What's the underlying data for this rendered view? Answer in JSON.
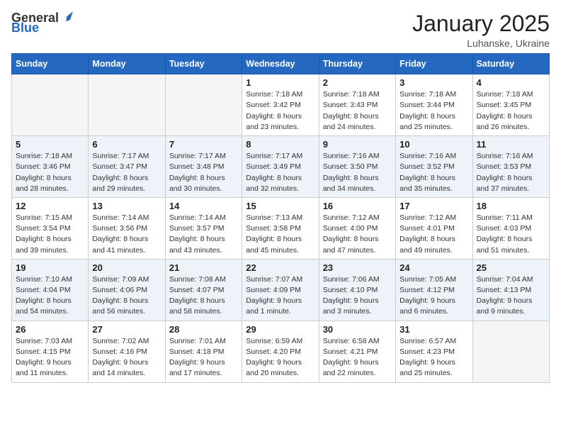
{
  "header": {
    "logo_general": "General",
    "logo_blue": "Blue",
    "month_title": "January 2025",
    "subtitle": "Luhanske, Ukraine"
  },
  "weekdays": [
    "Sunday",
    "Monday",
    "Tuesday",
    "Wednesday",
    "Thursday",
    "Friday",
    "Saturday"
  ],
  "weeks": [
    [
      {
        "day": "",
        "info": ""
      },
      {
        "day": "",
        "info": ""
      },
      {
        "day": "",
        "info": ""
      },
      {
        "day": "1",
        "info": "Sunrise: 7:18 AM\nSunset: 3:42 PM\nDaylight: 8 hours\nand 23 minutes."
      },
      {
        "day": "2",
        "info": "Sunrise: 7:18 AM\nSunset: 3:43 PM\nDaylight: 8 hours\nand 24 minutes."
      },
      {
        "day": "3",
        "info": "Sunrise: 7:18 AM\nSunset: 3:44 PM\nDaylight: 8 hours\nand 25 minutes."
      },
      {
        "day": "4",
        "info": "Sunrise: 7:18 AM\nSunset: 3:45 PM\nDaylight: 8 hours\nand 26 minutes."
      }
    ],
    [
      {
        "day": "5",
        "info": "Sunrise: 7:18 AM\nSunset: 3:46 PM\nDaylight: 8 hours\nand 28 minutes."
      },
      {
        "day": "6",
        "info": "Sunrise: 7:17 AM\nSunset: 3:47 PM\nDaylight: 8 hours\nand 29 minutes."
      },
      {
        "day": "7",
        "info": "Sunrise: 7:17 AM\nSunset: 3:48 PM\nDaylight: 8 hours\nand 30 minutes."
      },
      {
        "day": "8",
        "info": "Sunrise: 7:17 AM\nSunset: 3:49 PM\nDaylight: 8 hours\nand 32 minutes."
      },
      {
        "day": "9",
        "info": "Sunrise: 7:16 AM\nSunset: 3:50 PM\nDaylight: 8 hours\nand 34 minutes."
      },
      {
        "day": "10",
        "info": "Sunrise: 7:16 AM\nSunset: 3:52 PM\nDaylight: 8 hours\nand 35 minutes."
      },
      {
        "day": "11",
        "info": "Sunrise: 7:16 AM\nSunset: 3:53 PM\nDaylight: 8 hours\nand 37 minutes."
      }
    ],
    [
      {
        "day": "12",
        "info": "Sunrise: 7:15 AM\nSunset: 3:54 PM\nDaylight: 8 hours\nand 39 minutes."
      },
      {
        "day": "13",
        "info": "Sunrise: 7:14 AM\nSunset: 3:56 PM\nDaylight: 8 hours\nand 41 minutes."
      },
      {
        "day": "14",
        "info": "Sunrise: 7:14 AM\nSunset: 3:57 PM\nDaylight: 8 hours\nand 43 minutes."
      },
      {
        "day": "15",
        "info": "Sunrise: 7:13 AM\nSunset: 3:58 PM\nDaylight: 8 hours\nand 45 minutes."
      },
      {
        "day": "16",
        "info": "Sunrise: 7:12 AM\nSunset: 4:00 PM\nDaylight: 8 hours\nand 47 minutes."
      },
      {
        "day": "17",
        "info": "Sunrise: 7:12 AM\nSunset: 4:01 PM\nDaylight: 8 hours\nand 49 minutes."
      },
      {
        "day": "18",
        "info": "Sunrise: 7:11 AM\nSunset: 4:03 PM\nDaylight: 8 hours\nand 51 minutes."
      }
    ],
    [
      {
        "day": "19",
        "info": "Sunrise: 7:10 AM\nSunset: 4:04 PM\nDaylight: 8 hours\nand 54 minutes."
      },
      {
        "day": "20",
        "info": "Sunrise: 7:09 AM\nSunset: 4:06 PM\nDaylight: 8 hours\nand 56 minutes."
      },
      {
        "day": "21",
        "info": "Sunrise: 7:08 AM\nSunset: 4:07 PM\nDaylight: 8 hours\nand 58 minutes."
      },
      {
        "day": "22",
        "info": "Sunrise: 7:07 AM\nSunset: 4:09 PM\nDaylight: 9 hours\nand 1 minute."
      },
      {
        "day": "23",
        "info": "Sunrise: 7:06 AM\nSunset: 4:10 PM\nDaylight: 9 hours\nand 3 minutes."
      },
      {
        "day": "24",
        "info": "Sunrise: 7:05 AM\nSunset: 4:12 PM\nDaylight: 9 hours\nand 6 minutes."
      },
      {
        "day": "25",
        "info": "Sunrise: 7:04 AM\nSunset: 4:13 PM\nDaylight: 9 hours\nand 9 minutes."
      }
    ],
    [
      {
        "day": "26",
        "info": "Sunrise: 7:03 AM\nSunset: 4:15 PM\nDaylight: 9 hours\nand 11 minutes."
      },
      {
        "day": "27",
        "info": "Sunrise: 7:02 AM\nSunset: 4:16 PM\nDaylight: 9 hours\nand 14 minutes."
      },
      {
        "day": "28",
        "info": "Sunrise: 7:01 AM\nSunset: 4:18 PM\nDaylight: 9 hours\nand 17 minutes."
      },
      {
        "day": "29",
        "info": "Sunrise: 6:59 AM\nSunset: 4:20 PM\nDaylight: 9 hours\nand 20 minutes."
      },
      {
        "day": "30",
        "info": "Sunrise: 6:58 AM\nSunset: 4:21 PM\nDaylight: 9 hours\nand 22 minutes."
      },
      {
        "day": "31",
        "info": "Sunrise: 6:57 AM\nSunset: 4:23 PM\nDaylight: 9 hours\nand 25 minutes."
      },
      {
        "day": "",
        "info": ""
      }
    ]
  ]
}
